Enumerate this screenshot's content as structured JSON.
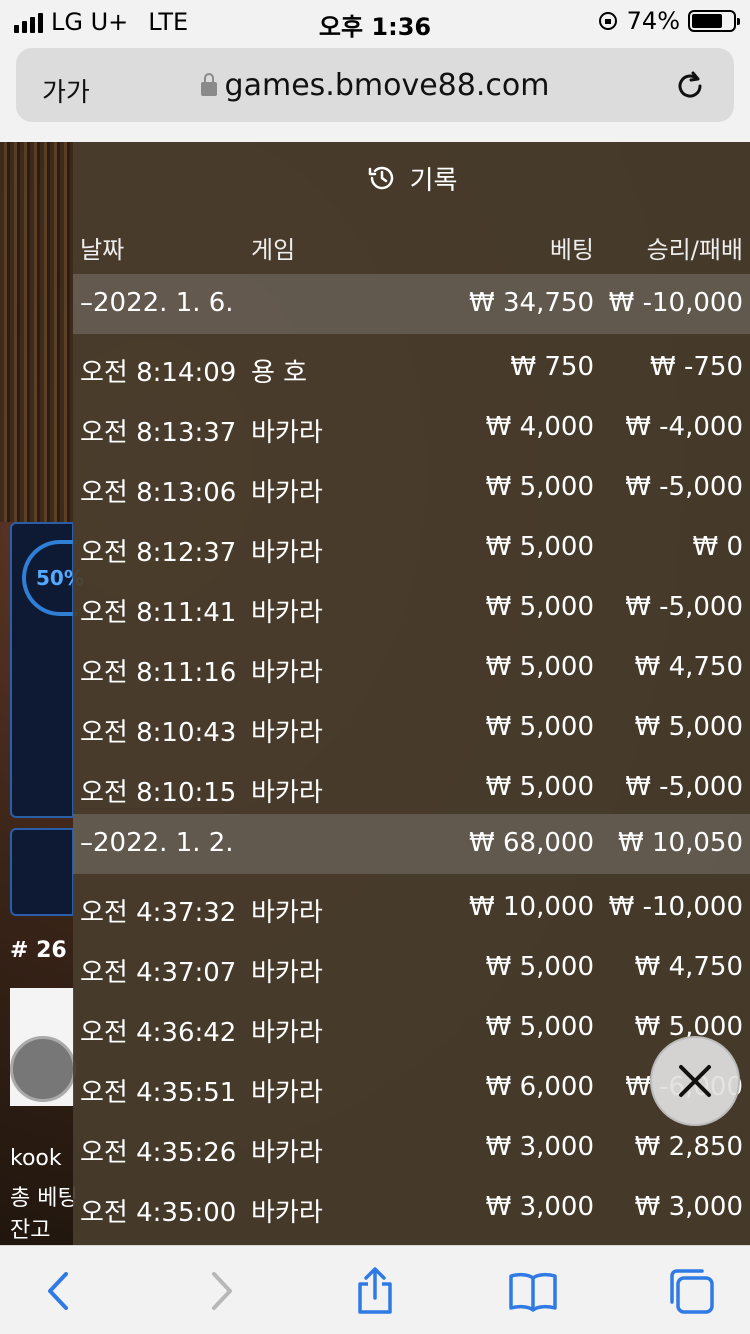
{
  "status": {
    "carrier": "LG U+",
    "network": "LTE",
    "time": "오후 1:36",
    "battery": "74%",
    "battery_level": 0.74
  },
  "browser": {
    "text_size": "가가",
    "url": "games.bmove88.com"
  },
  "background": {
    "percent": "50%",
    "table_no": "# 26",
    "user": "kook",
    "total_bet": "총 베팅",
    "balance": "잔고"
  },
  "history": {
    "title": "기록",
    "columns": {
      "date": "날짜",
      "game": "게임",
      "bet": "베팅",
      "result": "승리/패배"
    },
    "groups": [
      {
        "date": "–2022. 1. 6.",
        "bet": "₩ 34,750",
        "result": "₩ -10,000",
        "rows": [
          {
            "time": "오전 8:14:09",
            "game": "용 호",
            "bet": "₩ 750",
            "result": "₩ -750"
          },
          {
            "time": "오전 8:13:37",
            "game": "바카라",
            "bet": "₩ 4,000",
            "result": "₩ -4,000"
          },
          {
            "time": "오전 8:13:06",
            "game": "바카라",
            "bet": "₩ 5,000",
            "result": "₩ -5,000"
          },
          {
            "time": "오전 8:12:37",
            "game": "바카라",
            "bet": "₩ 5,000",
            "result": "₩ 0"
          },
          {
            "time": "오전 8:11:41",
            "game": "바카라",
            "bet": "₩ 5,000",
            "result": "₩ -5,000"
          },
          {
            "time": "오전 8:11:16",
            "game": "바카라",
            "bet": "₩ 5,000",
            "result": "₩ 4,750"
          },
          {
            "time": "오전 8:10:43",
            "game": "바카라",
            "bet": "₩ 5,000",
            "result": "₩ 5,000"
          },
          {
            "time": "오전 8:10:15",
            "game": "바카라",
            "bet": "₩ 5,000",
            "result": "₩ -5,000"
          }
        ]
      },
      {
        "date": "–2022. 1. 2.",
        "bet": "₩ 68,000",
        "result": "₩ 10,050",
        "rows": [
          {
            "time": "오전 4:37:32",
            "game": "바카라",
            "bet": "₩ 10,000",
            "result": "₩ -10,000"
          },
          {
            "time": "오전 4:37:07",
            "game": "바카라",
            "bet": "₩ 5,000",
            "result": "₩ 4,750"
          },
          {
            "time": "오전 4:36:42",
            "game": "바카라",
            "bet": "₩ 5,000",
            "result": "₩ 5,000"
          },
          {
            "time": "오전 4:35:51",
            "game": "바카라",
            "bet": "₩ 6,000",
            "result": "₩ -6,000"
          },
          {
            "time": "오전 4:35:26",
            "game": "바카라",
            "bet": "₩ 3,000",
            "result": "₩ 2,850"
          },
          {
            "time": "오전 4:35:00",
            "game": "바카라",
            "bet": "₩ 3,000",
            "result": "₩ 3,000"
          }
        ]
      }
    ]
  },
  "icons": {
    "reload": "reload-icon",
    "history": "history-icon",
    "close": "close-icon",
    "back": "back-arrow-icon",
    "forward": "forward-arrow-icon",
    "share": "share-icon",
    "bookmarks": "bookmarks-icon",
    "tabs": "tabs-icon"
  },
  "colors": {
    "accent": "#2f7ae5",
    "panel": "#483c2c",
    "toolbar": "#f2f2f2"
  }
}
